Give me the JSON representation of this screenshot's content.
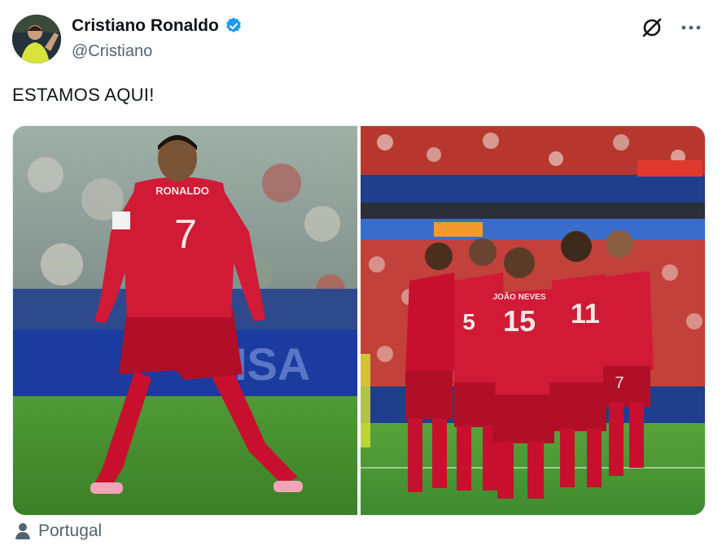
{
  "post": {
    "display_name": "Cristiano Ronaldo",
    "handle": "@Cristiano",
    "text": "ESTAMOS AQUI!",
    "verified": true,
    "location": "Portugal"
  },
  "media": {
    "left_photo": {
      "jersey_name": "RONALDO",
      "jersey_number": "7",
      "ad_board": "VISA"
    },
    "right_photo": {
      "jersey_name_a": "JOÃO NEVES",
      "jersey_number_a": "15",
      "jersey_number_b": "11",
      "jersey_number_c": "7",
      "jersey_number_d": "5"
    }
  },
  "icons": {
    "verified": "verified-badge-icon",
    "grok": "grok-icon",
    "more": "more-options-icon",
    "location": "person-icon"
  },
  "colors": {
    "accent_blue": "#1d9bf0",
    "text_primary": "#0f1419",
    "text_secondary": "#536471",
    "jersey_red": "#c8102e",
    "pitch_green": "#3f8a2f"
  }
}
